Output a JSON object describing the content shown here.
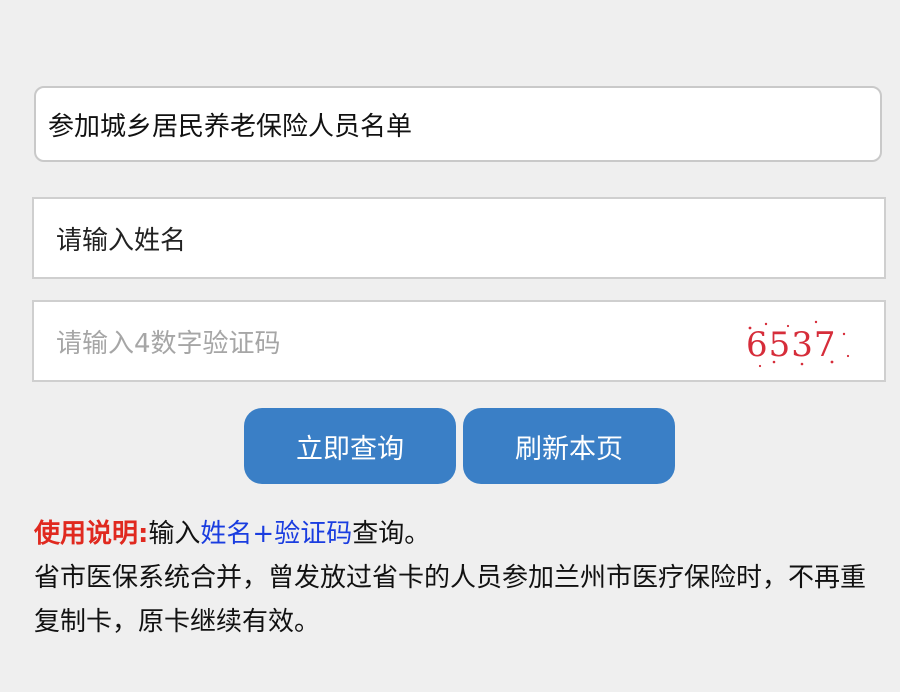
{
  "category_select": {
    "value": "参加城乡居民养老保险人员名单"
  },
  "name_input": {
    "placeholder": "请输入姓名"
  },
  "code_input": {
    "placeholder": "请输入4数字验证码",
    "captcha_text": "6537"
  },
  "buttons": {
    "query_label": "立即查询",
    "refresh_label": "刷新本页"
  },
  "instructions": {
    "label": "使用说明:",
    "text_1": "输入",
    "highlight": "姓名+验证码",
    "text_2": "查询。",
    "line_2": "省市医保系统合并，曾发放过省卡的人员参加兰州市医疗保险时，不再重复制卡，原卡继续有效。"
  },
  "colors": {
    "button_bg": "#3a7fc6",
    "instruction_label": "#e0291f",
    "instruction_highlight": "#1a3de0",
    "captcha_text": "#d62d3a"
  }
}
